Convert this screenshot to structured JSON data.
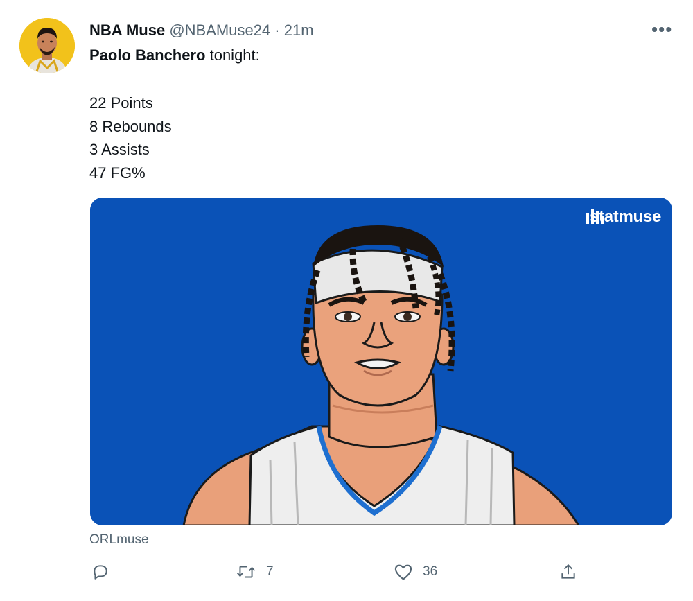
{
  "tweet": {
    "display_name": "NBA Muse",
    "handle": "@NBAMuse24",
    "separator": "·",
    "time": "21m",
    "more_label": "•••",
    "text_subject": "Paolo Banchero",
    "text_rest": " tonight:",
    "stats": [
      "22 Points",
      "8 Rebounds",
      "3 Assists",
      "47 FG%"
    ]
  },
  "card": {
    "brand": "statmuse",
    "source": "ORLmuse",
    "background_color": "#0a52b7"
  },
  "actions": {
    "reply_icon": "reply-icon",
    "retweet_icon": "retweet-icon",
    "retweet_count": "7",
    "like_icon": "heart-icon",
    "like_count": "36",
    "share_icon": "share-icon"
  },
  "colors": {
    "text_primary": "#0f1419",
    "text_secondary": "#536471",
    "avatar_bg": "#f2c21b"
  }
}
